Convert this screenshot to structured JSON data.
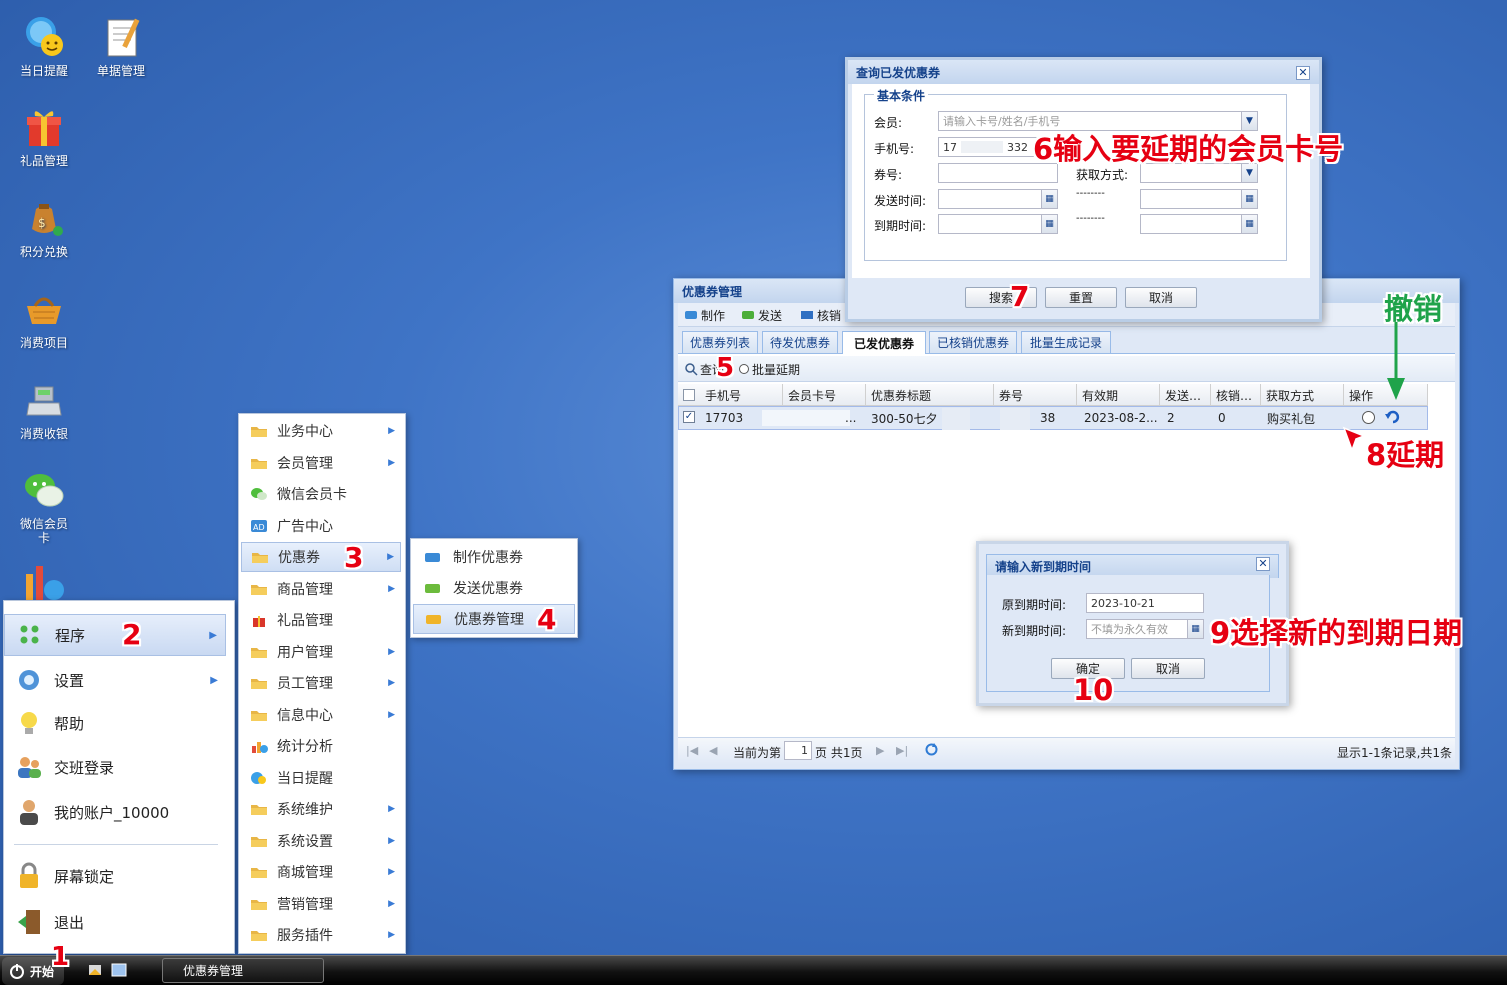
{
  "desktop": {
    "icons": [
      "当日提醒",
      "单据管理",
      "礼品管理",
      "积分兑换",
      "消费项目",
      "消费收银",
      "微信会员卡"
    ]
  },
  "taskbar": {
    "start_label": "开始",
    "task_label": "优惠券管理"
  },
  "start_menu": {
    "items": [
      "程序",
      "设置",
      "帮助",
      "交班登录",
      "我的账户_10000",
      "屏幕锁定",
      "退出"
    ]
  },
  "program_menu": {
    "items": [
      "业务中心",
      "会员管理",
      "微信会员卡",
      "广告中心",
      "优惠券",
      "商品管理",
      "礼品管理",
      "用户管理",
      "员工管理",
      "信息中心",
      "统计分析",
      "当日提醒",
      "系统维护",
      "系统设置",
      "商城管理",
      "营销管理",
      "服务插件"
    ]
  },
  "coupon_menu": {
    "items": [
      "制作优惠券",
      "发送优惠券",
      "优惠券管理"
    ]
  },
  "coupon_window": {
    "title": "优惠券管理",
    "toolbar": [
      "制作",
      "发送",
      "核销"
    ],
    "tabs": [
      "优惠券列表",
      "待发优惠券",
      "已发优惠券",
      "已核销优惠券",
      "批量生成记录"
    ],
    "query_label": "查询",
    "batch_label": "批量延期",
    "columns": [
      "手机号",
      "会员卡号",
      "优惠券标题",
      "券号",
      "有效期",
      "发送…",
      "核销…",
      "获取方式",
      "操作"
    ],
    "row": {
      "phone": "17703",
      "title": "300-50七夕",
      "ellipsis": "...",
      "coupon_no": "38",
      "valid": "2023-08-2...",
      "sent": "2",
      "used": "0",
      "method": "购买礼包"
    },
    "pager": {
      "prefix": "当前为第",
      "page": "1",
      "suffix": "页 共1页",
      "summary": "显示1-1条记录,共1条"
    }
  },
  "query_dialog": {
    "title": "查询已发优惠券",
    "legend": "基本条件",
    "member_label": "会员:",
    "member_placeholder": "请输入卡号/姓名/手机号",
    "phone_label": "手机号:",
    "phone_value_start": "17",
    "phone_value_end": "332",
    "coupon_label": "券号:",
    "method_label": "获取方式:",
    "send_time_label": "发送时间:",
    "expire_time_label": "到期时间:",
    "range_sep": "--------",
    "buttons": [
      "搜索",
      "重置",
      "取消"
    ]
  },
  "expiry_dialog": {
    "title": "请输入新到期时间",
    "orig_label": "原到期时间:",
    "orig_value": "2023-10-21",
    "new_label": "新到期时间:",
    "new_placeholder": "不填为永久有效",
    "ok": "确定",
    "cancel": "取消"
  },
  "annotations": {
    "n1": "1",
    "n2": "2",
    "n3": "3",
    "n4": "4",
    "n5": "5",
    "n6": "6输入要延期的会员卡号",
    "n7": "7",
    "revoke": "撤销",
    "n8": "8延期",
    "n9": "9选择新的到期日期",
    "n10": "10"
  },
  "colors": {
    "desktop": "#3f74c6",
    "annotation_red": "#e60012",
    "annotation_green": "#1fa34a",
    "window_title": "#15428b"
  }
}
